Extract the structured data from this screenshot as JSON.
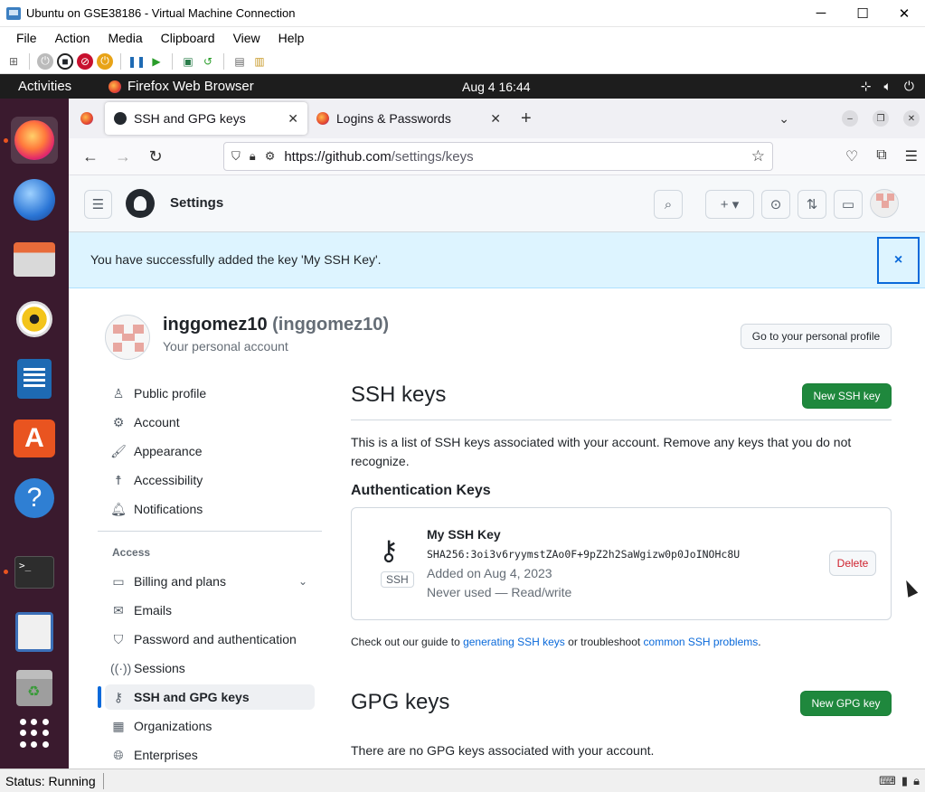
{
  "vm": {
    "title": "Ubuntu on GSE38186 - Virtual Machine Connection",
    "menu": [
      "File",
      "Action",
      "Media",
      "Clipboard",
      "View",
      "Help"
    ],
    "status": "Status: Running",
    "minimize": "─",
    "maximize": "☐",
    "close": "✕"
  },
  "gnome": {
    "activities": "Activities",
    "app": "Firefox Web Browser",
    "clock": "Aug 4  16:44"
  },
  "firefox": {
    "tabs": [
      {
        "label": "SSH and GPG keys",
        "close": "✕"
      },
      {
        "label": "Logins & Passwords",
        "close": "✕"
      }
    ],
    "new_tab": "+",
    "tab_list": "⌄",
    "url_host": "https://github.com",
    "url_path": "/settings/keys"
  },
  "github": {
    "header_title": "Settings",
    "flash": "You have successfully added the key 'My SSH Key'.",
    "flash_close": "×",
    "user": {
      "name": "inggomez10",
      "handle": "(inggomez10)",
      "subtitle": "Your personal account",
      "profile_button": "Go to your personal profile"
    },
    "nav": {
      "items_top": [
        {
          "label": "Public profile",
          "icon": "person-icon"
        },
        {
          "label": "Account",
          "icon": "gear-icon"
        },
        {
          "label": "Appearance",
          "icon": "paintbrush-icon"
        },
        {
          "label": "Accessibility",
          "icon": "accessibility-icon"
        },
        {
          "label": "Notifications",
          "icon": "bell-icon"
        }
      ],
      "access_label": "Access",
      "items_access": [
        {
          "label": "Billing and plans",
          "icon": "credit-card-icon"
        },
        {
          "label": "Emails",
          "icon": "mail-icon"
        },
        {
          "label": "Password and authentication",
          "icon": "shield-icon"
        },
        {
          "label": "Sessions",
          "icon": "broadcast-icon"
        },
        {
          "label": "SSH and GPG keys",
          "icon": "key-icon"
        },
        {
          "label": "Organizations",
          "icon": "organization-icon"
        },
        {
          "label": "Enterprises",
          "icon": "globe-icon"
        }
      ]
    },
    "ssh": {
      "title": "SSH keys",
      "new_button": "New SSH key",
      "description": "This is a list of SSH keys associated with your account. Remove any keys that you do not recognize.",
      "auth_title": "Authentication Keys",
      "key": {
        "name": "My SSH Key",
        "fingerprint": "SHA256:3oi3v6ryymstZAo0F+9pZ2h2SaWgizw0p0JoINOHc8U",
        "added": "Added on Aug 4, 2023",
        "usage": "Never used — Read/write",
        "badge": "SSH",
        "delete": "Delete"
      },
      "guide_prefix": "Check out our guide to ",
      "guide_link1": "generating SSH keys",
      "guide_mid": " or troubleshoot ",
      "guide_link2": "common SSH problems",
      "guide_suffix": "."
    },
    "gpg": {
      "title": "GPG keys",
      "new_button": "New GPG key",
      "empty": "There are no GPG keys associated with your account."
    }
  }
}
